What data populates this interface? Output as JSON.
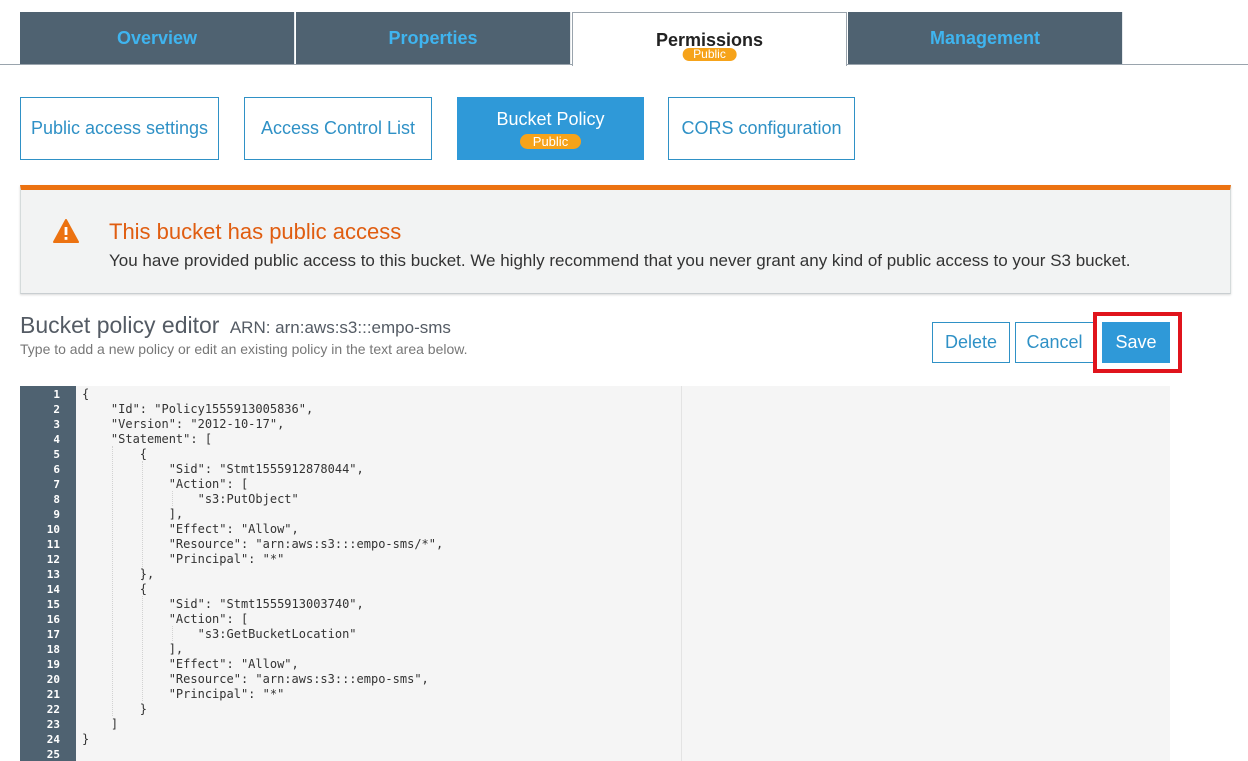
{
  "top_tabs": [
    {
      "label": "Overview"
    },
    {
      "label": "Properties"
    },
    {
      "label": "Permissions",
      "badge": "Public"
    },
    {
      "label": "Management"
    }
  ],
  "sub_tabs": [
    {
      "label": "Public access settings"
    },
    {
      "label": "Access Control List"
    },
    {
      "label": "Bucket Policy",
      "badge": "Public"
    },
    {
      "label": "CORS configuration"
    }
  ],
  "alert": {
    "title": "This bucket has public access",
    "body": "You have provided public access to this bucket. We highly recommend that you never grant any kind of public access to your S3 bucket."
  },
  "editor": {
    "title": "Bucket policy editor",
    "arn": "ARN: arn:aws:s3:::empo-sms",
    "subtitle": "Type to add a new policy or edit an existing policy in the text area below.",
    "delete_label": "Delete",
    "cancel_label": "Cancel",
    "save_label": "Save",
    "lines": [
      "{",
      "    \"Id\": \"Policy1555913005836\",",
      "    \"Version\": \"2012-10-17\",",
      "    \"Statement\": [",
      "        {",
      "            \"Sid\": \"Stmt1555912878044\",",
      "            \"Action\": [",
      "                \"s3:PutObject\"",
      "            ],",
      "            \"Effect\": \"Allow\",",
      "            \"Resource\": \"arn:aws:s3:::empo-sms/*\",",
      "            \"Principal\": \"*\"",
      "        },",
      "        {",
      "            \"Sid\": \"Stmt1555913003740\",",
      "            \"Action\": [",
      "                \"s3:GetBucketLocation\"",
      "            ],",
      "            \"Effect\": \"Allow\",",
      "            \"Resource\": \"arn:aws:s3:::empo-sms\",",
      "            \"Principal\": \"*\"",
      "        }",
      "    ]",
      "}",
      ""
    ],
    "line_numbers": [
      "1",
      "2",
      "3",
      "4",
      "5",
      "6",
      "7",
      "8",
      "9",
      "10",
      "11",
      "12",
      "13",
      "14",
      "15",
      "16",
      "17",
      "18",
      "19",
      "20",
      "21",
      "22",
      "23",
      "24",
      "25"
    ]
  },
  "colors": {
    "tab_bg": "#4f6271",
    "tab_text": "#3fb4ef",
    "accent": "#2f99d8",
    "badge": "#f6a31a",
    "warning": "#ec7211",
    "highlight": "#e0141c"
  },
  "icons": {
    "alert": "warning-triangle-icon"
  }
}
